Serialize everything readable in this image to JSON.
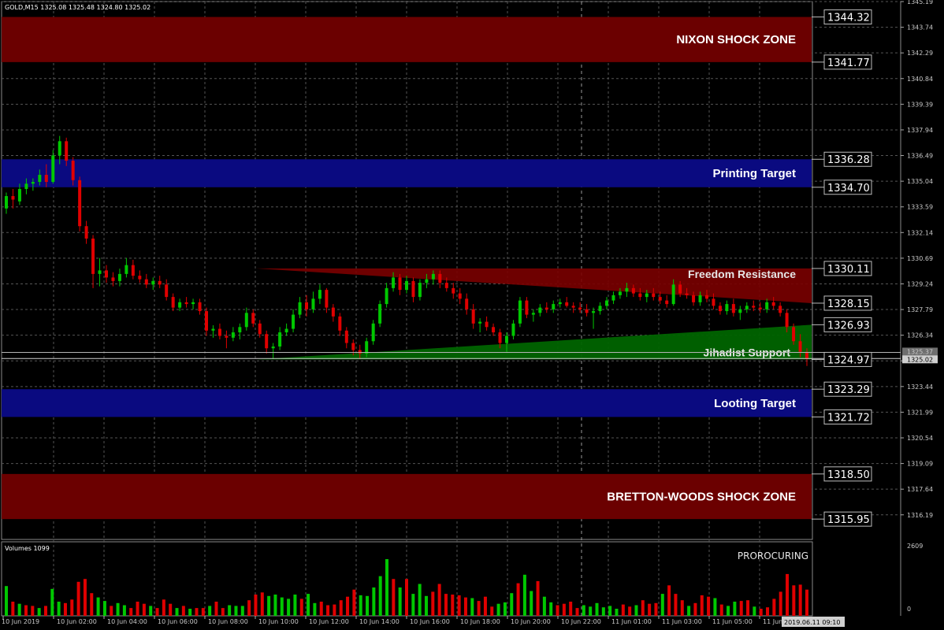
{
  "symbol_info": "GOLD,M15  1325.08 1325.48 1324.80 1325.02",
  "volume_info": "Volumes 1099",
  "indicator_tag": "PROROCURING",
  "current_price_labels": [
    "1325.37",
    "1325.02"
  ],
  "time_highlight": "2019.06.11 09:10",
  "colors": {
    "shock_zone": "#6b0000",
    "target_zone": "#0a0a80",
    "resistance": "#7a0000",
    "support": "#006400",
    "bull_candle": "#00c800",
    "bear_candle": "#e00000",
    "grid": "#555555"
  },
  "zones": [
    {
      "name": "NIXON SHOCK ZONE",
      "top": 1344.32,
      "bottom": 1341.77,
      "kind": "shock"
    },
    {
      "name": "Printing Target",
      "top": 1336.28,
      "bottom": 1334.7,
      "kind": "target"
    },
    {
      "name": "Looting Target",
      "top": 1323.29,
      "bottom": 1321.72,
      "kind": "target"
    },
    {
      "name": "BRETTON-WOODS SHOCK ZONE",
      "top": 1318.5,
      "bottom": 1315.95,
      "kind": "shock"
    }
  ],
  "resistance": {
    "label": "Freedom Resistance",
    "level_box_a": "1330.11",
    "level_box_b": "1328.15",
    "start": 1330.11,
    "end_top": 1330.11,
    "end_bottom": 1328.15
  },
  "support": {
    "label": "Jihadist Support",
    "level_box_a": "1326.93",
    "level_box_b": "1324.97",
    "start": 1324.97,
    "end_top": 1326.93,
    "end_bottom": 1324.97
  },
  "level_boxes": [
    "1344.32",
    "1341.77",
    "1336.28",
    "1334.70",
    "1330.11",
    "1328.15",
    "1326.93",
    "1324.97",
    "1323.29",
    "1321.72",
    "1318.50",
    "1315.95"
  ],
  "chart_data": {
    "type": "candlestick",
    "price_axis": {
      "min": 1314.8,
      "max": 1345.19,
      "ticks": [
        1345.19,
        1343.74,
        1342.29,
        1340.84,
        1339.39,
        1337.94,
        1336.49,
        1335.04,
        1333.59,
        1332.14,
        1330.69,
        1329.24,
        1327.79,
        1326.34,
        1324.89,
        1323.44,
        1321.99,
        1320.54,
        1319.09,
        1317.64,
        1316.19
      ]
    },
    "time_axis": [
      "10 Jun 2019",
      "10 Jun 02:00",
      "10 Jun 04:00",
      "10 Jun 06:00",
      "10 Jun 08:00",
      "10 Jun 10:00",
      "10 Jun 12:00",
      "10 Jun 14:00",
      "10 Jun 16:00",
      "10 Jun 18:00",
      "10 Jun 20:00",
      "10 Jun 22:00",
      "11 Jun 01:00",
      "11 Jun 03:00",
      "11 Jun 05:00",
      "11 Jun"
    ],
    "volume_axis": {
      "max": 2609,
      "min": 0
    },
    "candles": [
      [
        1333.5,
        1334.4,
        1333.2,
        1334.2
      ],
      [
        1334.2,
        1334.6,
        1333.5,
        1334.0
      ],
      [
        1333.9,
        1334.9,
        1333.7,
        1334.6
      ],
      [
        1334.6,
        1335.2,
        1334.3,
        1334.9
      ],
      [
        1334.9,
        1335.2,
        1334.5,
        1335.0
      ],
      [
        1335.0,
        1335.7,
        1334.8,
        1335.4
      ],
      [
        1335.4,
        1336.0,
        1334.7,
        1335.0
      ],
      [
        1335.0,
        1336.8,
        1334.9,
        1336.5
      ],
      [
        1336.5,
        1337.6,
        1336.0,
        1337.3
      ],
      [
        1337.3,
        1337.5,
        1335.9,
        1336.2
      ],
      [
        1336.2,
        1336.4,
        1334.8,
        1335.1
      ],
      [
        1335.1,
        1335.3,
        1332.2,
        1332.5
      ],
      [
        1332.5,
        1332.8,
        1331.5,
        1331.8
      ],
      [
        1331.8,
        1332.0,
        1329.0,
        1329.8
      ],
      [
        1329.8,
        1330.7,
        1329.1,
        1330.0
      ],
      [
        1330.0,
        1330.3,
        1329.3,
        1329.6
      ],
      [
        1329.6,
        1329.9,
        1329.1,
        1329.4
      ],
      [
        1329.4,
        1330.1,
        1329.1,
        1329.8
      ],
      [
        1329.8,
        1330.7,
        1329.6,
        1330.3
      ],
      [
        1330.3,
        1330.6,
        1329.5,
        1329.7
      ],
      [
        1329.7,
        1330.0,
        1329.3,
        1329.5
      ],
      [
        1329.5,
        1329.8,
        1329.0,
        1329.2
      ],
      [
        1329.2,
        1329.6,
        1328.9,
        1329.4
      ],
      [
        1329.4,
        1329.7,
        1329.0,
        1329.2
      ],
      [
        1329.2,
        1329.5,
        1328.3,
        1328.5
      ],
      [
        1328.5,
        1328.7,
        1327.7,
        1327.9
      ],
      [
        1327.9,
        1328.4,
        1327.7,
        1328.2
      ],
      [
        1328.2,
        1328.5,
        1327.9,
        1328.1
      ],
      [
        1328.1,
        1328.4,
        1327.8,
        1328.2
      ],
      [
        1328.2,
        1328.4,
        1327.5,
        1327.7
      ],
      [
        1327.7,
        1327.9,
        1326.3,
        1326.6
      ],
      [
        1326.6,
        1326.9,
        1326.2,
        1326.7
      ],
      [
        1326.7,
        1327.0,
        1326.1,
        1326.3
      ],
      [
        1326.3,
        1326.6,
        1325.6,
        1326.2
      ],
      [
        1326.2,
        1326.8,
        1326.0,
        1326.5
      ],
      [
        1326.5,
        1327.0,
        1326.1,
        1326.8
      ],
      [
        1326.8,
        1327.9,
        1326.6,
        1327.6
      ],
      [
        1327.6,
        1327.8,
        1326.8,
        1327.0
      ],
      [
        1327.0,
        1327.2,
        1326.2,
        1326.4
      ],
      [
        1326.4,
        1326.6,
        1325.3,
        1325.6
      ],
      [
        1325.6,
        1325.9,
        1325.0,
        1325.7
      ],
      [
        1325.7,
        1326.8,
        1325.5,
        1326.5
      ],
      [
        1326.5,
        1327.0,
        1326.3,
        1326.7
      ],
      [
        1326.7,
        1327.8,
        1326.5,
        1327.5
      ],
      [
        1327.5,
        1328.5,
        1327.3,
        1328.2
      ],
      [
        1328.2,
        1328.6,
        1327.4,
        1327.8
      ],
      [
        1327.8,
        1328.8,
        1327.6,
        1328.4
      ],
      [
        1328.4,
        1329.2,
        1328.1,
        1328.9
      ],
      [
        1328.9,
        1329.0,
        1327.6,
        1327.9
      ],
      [
        1327.9,
        1328.1,
        1327.1,
        1327.4
      ],
      [
        1327.4,
        1327.6,
        1326.3,
        1326.6
      ],
      [
        1326.6,
        1326.8,
        1325.6,
        1325.9
      ],
      [
        1325.9,
        1326.1,
        1325.2,
        1325.5
      ],
      [
        1325.5,
        1325.8,
        1325.0,
        1325.3
      ],
      [
        1325.3,
        1326.2,
        1325.1,
        1326.0
      ],
      [
        1326.0,
        1327.2,
        1325.8,
        1327.0
      ],
      [
        1327.0,
        1328.3,
        1326.8,
        1328.1
      ],
      [
        1328.1,
        1329.3,
        1327.9,
        1329.0
      ],
      [
        1329.0,
        1329.9,
        1328.8,
        1329.6
      ],
      [
        1329.6,
        1329.8,
        1328.6,
        1328.9
      ],
      [
        1328.9,
        1329.7,
        1328.7,
        1329.4
      ],
      [
        1329.4,
        1329.6,
        1328.2,
        1328.5
      ],
      [
        1328.5,
        1329.5,
        1328.3,
        1329.3
      ],
      [
        1329.3,
        1329.8,
        1329.0,
        1329.5
      ],
      [
        1329.5,
        1330.0,
        1329.2,
        1329.8
      ],
      [
        1329.8,
        1330.0,
        1329.0,
        1329.3
      ],
      [
        1329.3,
        1329.6,
        1328.8,
        1329.0
      ],
      [
        1329.0,
        1329.3,
        1328.4,
        1328.7
      ],
      [
        1328.7,
        1329.0,
        1328.1,
        1328.4
      ],
      [
        1328.4,
        1328.7,
        1327.5,
        1327.8
      ],
      [
        1327.8,
        1328.1,
        1326.7,
        1327.0
      ],
      [
        1327.0,
        1327.3,
        1326.5,
        1327.1
      ],
      [
        1327.1,
        1327.4,
        1326.6,
        1326.8
      ],
      [
        1326.8,
        1327.0,
        1326.3,
        1326.5
      ],
      [
        1326.5,
        1326.7,
        1325.6,
        1325.9
      ],
      [
        1325.9,
        1326.5,
        1325.4,
        1326.3
      ],
      [
        1326.3,
        1327.2,
        1326.1,
        1327.0
      ],
      [
        1327.0,
        1328.5,
        1326.8,
        1328.3
      ],
      [
        1328.3,
        1328.5,
        1327.3,
        1327.5
      ],
      [
        1327.5,
        1327.8,
        1327.1,
        1327.6
      ],
      [
        1327.6,
        1328.1,
        1327.4,
        1327.9
      ],
      [
        1327.9,
        1328.2,
        1327.6,
        1327.8
      ],
      [
        1327.8,
        1328.3,
        1327.6,
        1328.1
      ],
      [
        1328.1,
        1328.4,
        1327.9,
        1328.2
      ],
      [
        1328.2,
        1328.5,
        1327.9,
        1328.0
      ],
      [
        1328.0,
        1328.2,
        1327.6,
        1327.9
      ],
      [
        1327.9,
        1328.2,
        1327.6,
        1327.8
      ],
      [
        1327.8,
        1328.1,
        1327.4,
        1327.6
      ],
      [
        1327.6,
        1327.9,
        1326.7,
        1327.7
      ],
      [
        1327.7,
        1328.2,
        1327.5,
        1328.0
      ],
      [
        1328.0,
        1328.5,
        1327.8,
        1328.3
      ],
      [
        1328.3,
        1328.8,
        1328.1,
        1328.6
      ],
      [
        1328.6,
        1329.0,
        1328.4,
        1328.8
      ],
      [
        1328.8,
        1329.3,
        1328.5,
        1329.0
      ],
      [
        1329.0,
        1329.2,
        1328.5,
        1328.7
      ],
      [
        1328.7,
        1329.0,
        1328.3,
        1328.5
      ],
      [
        1328.5,
        1328.9,
        1328.2,
        1328.7
      ],
      [
        1328.7,
        1329.0,
        1328.3,
        1328.5
      ],
      [
        1328.5,
        1328.8,
        1328.1,
        1328.3
      ],
      [
        1328.3,
        1328.6,
        1327.9,
        1328.1
      ],
      [
        1328.1,
        1329.5,
        1328.0,
        1329.2
      ],
      [
        1329.2,
        1329.4,
        1328.5,
        1328.7
      ],
      [
        1328.7,
        1329.0,
        1328.4,
        1328.6
      ],
      [
        1328.6,
        1328.8,
        1328.0,
        1328.2
      ],
      [
        1328.2,
        1328.8,
        1328.0,
        1328.6
      ],
      [
        1328.6,
        1328.9,
        1328.2,
        1328.4
      ],
      [
        1328.4,
        1328.7,
        1327.8,
        1328.0
      ],
      [
        1328.0,
        1328.2,
        1327.5,
        1327.7
      ],
      [
        1327.7,
        1328.3,
        1327.5,
        1328.1
      ],
      [
        1328.1,
        1328.4,
        1327.4,
        1327.6
      ],
      [
        1327.6,
        1328.0,
        1327.2,
        1327.8
      ],
      [
        1327.8,
        1328.2,
        1327.6,
        1328.0
      ],
      [
        1328.0,
        1328.3,
        1327.7,
        1327.9
      ],
      [
        1327.9,
        1328.2,
        1327.6,
        1327.8
      ],
      [
        1327.8,
        1328.4,
        1327.6,
        1328.2
      ],
      [
        1328.2,
        1328.5,
        1327.8,
        1328.0
      ],
      [
        1328.0,
        1328.2,
        1327.4,
        1327.6
      ],
      [
        1327.6,
        1327.8,
        1326.5,
        1326.8
      ],
      [
        1326.8,
        1327.0,
        1325.8,
        1326.0
      ],
      [
        1326.0,
        1326.4,
        1325.1,
        1325.4
      ],
      [
        1325.4,
        1325.6,
        1324.6,
        1325.0
      ]
    ],
    "volumes": [
      0.42,
      0.2,
      0.17,
      0.15,
      0.14,
      0.11,
      0.14,
      0.38,
      0.2,
      0.18,
      0.23,
      0.48,
      0.52,
      0.32,
      0.26,
      0.21,
      0.14,
      0.18,
      0.15,
      0.11,
      0.2,
      0.17,
      0.14,
      0.11,
      0.23,
      0.17,
      0.11,
      0.14,
      0.1,
      0.11,
      0.11,
      0.14,
      0.2,
      0.11,
      0.15,
      0.14,
      0.14,
      0.22,
      0.3,
      0.33,
      0.28,
      0.3,
      0.26,
      0.24,
      0.3,
      0.24,
      0.31,
      0.18,
      0.2,
      0.15,
      0.16,
      0.22,
      0.27,
      0.37,
      0.29,
      0.28,
      0.4,
      0.56,
      0.8,
      0.52,
      0.4,
      0.52,
      0.31,
      0.45,
      0.28,
      0.34,
      0.45,
      0.31,
      0.3,
      0.29,
      0.26,
      0.25,
      0.21,
      0.27,
      0.13,
      0.17,
      0.19,
      0.32,
      0.46,
      0.58,
      0.35,
      0.49,
      0.27,
      0.19,
      0.15,
      0.17,
      0.2,
      0.11,
      0.15,
      0.13,
      0.18,
      0.12,
      0.14,
      0.1,
      0.16,
      0.13,
      0.15,
      0.22,
      0.17,
      0.18,
      0.31,
      0.43,
      0.31,
      0.22,
      0.14,
      0.18,
      0.29,
      0.27,
      0.25,
      0.16,
      0.14,
      0.2,
      0.21,
      0.22,
      0.13,
      0.1,
      0.12,
      0.24,
      0.34,
      0.59,
      0.43,
      0.44,
      0.37
    ],
    "volume_up": [
      1,
      0,
      1,
      0,
      0,
      1,
      0,
      1,
      1,
      0,
      0,
      0,
      0,
      0,
      1,
      1,
      0,
      1,
      1,
      0,
      0,
      0,
      1,
      0,
      0,
      0,
      1,
      0,
      1,
      0,
      0,
      1,
      0,
      0,
      1,
      1,
      1,
      0,
      0,
      0,
      1,
      1,
      1,
      1,
      1,
      0,
      1,
      1,
      0,
      0,
      0,
      0,
      0,
      0,
      1,
      1,
      1,
      1,
      1,
      0,
      1,
      0,
      1,
      1,
      1,
      0,
      0,
      0,
      0,
      0,
      0,
      1,
      0,
      0,
      0,
      1,
      1,
      1,
      0,
      1,
      1,
      0,
      1,
      1,
      0,
      0,
      0,
      0,
      1,
      1,
      1,
      1,
      1,
      1,
      0,
      0,
      1,
      0,
      0,
      0,
      1,
      0,
      0,
      0,
      1,
      0,
      0,
      0,
      1,
      0,
      1,
      1,
      0,
      0,
      1,
      0,
      0,
      0,
      0,
      0,
      0,
      0,
      0
    ]
  }
}
